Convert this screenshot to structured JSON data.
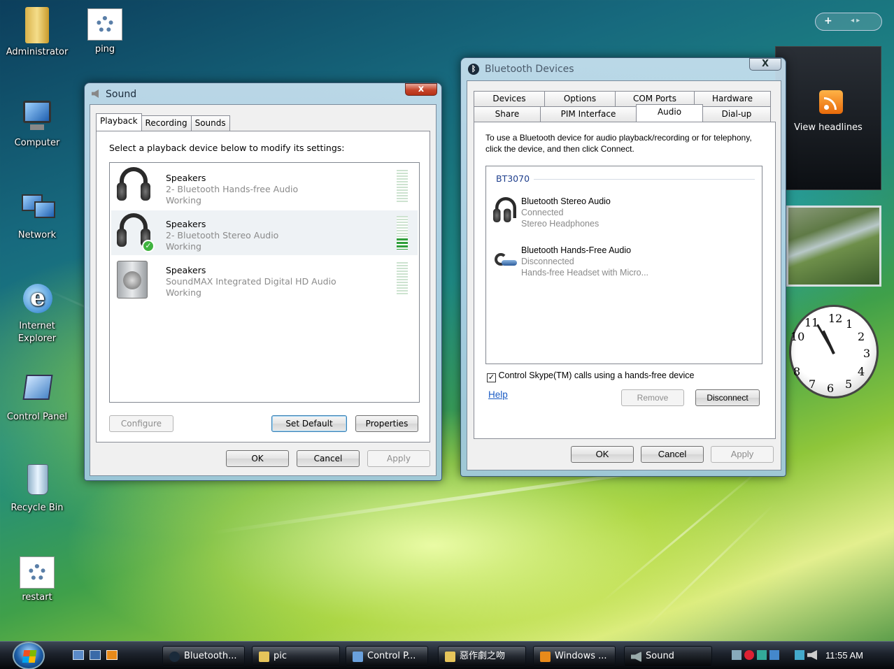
{
  "desktop": {
    "icons": [
      {
        "label": "Administrator"
      },
      {
        "label": "ping"
      },
      {
        "label": "Computer"
      },
      {
        "label": "Network"
      },
      {
        "label": "Internet Explorer"
      },
      {
        "label": "Control Panel"
      },
      {
        "label": "Recycle Bin"
      },
      {
        "label": "restart"
      }
    ]
  },
  "sidebar": {
    "add_label": "+",
    "nav_label": "◂ ▸",
    "feed_label": "View headlines",
    "clock_numbers": [
      "12",
      "1",
      "2",
      "3",
      "4",
      "5",
      "6",
      "7",
      "8",
      "10",
      "11"
    ]
  },
  "sound": {
    "title": "Sound",
    "close_glyph": "x",
    "tabs": [
      "Playback",
      "Recording",
      "Sounds"
    ],
    "instruction": "Select a playback device below to modify its settings:",
    "devices": [
      {
        "name": "Speakers",
        "desc": "2- Bluetooth Hands-free Audio",
        "status": "Working"
      },
      {
        "name": "Speakers",
        "desc": "2- Bluetooth Stereo Audio",
        "status": "Working"
      },
      {
        "name": "Speakers",
        "desc": "SoundMAX Integrated Digital HD Audio",
        "status": "Working"
      }
    ],
    "buttons": {
      "configure": "Configure",
      "set_default": "Set Default",
      "properties": "Properties",
      "ok": "OK",
      "cancel": "Cancel",
      "apply": "Apply"
    }
  },
  "bluetooth": {
    "title": "Bluetooth Devices",
    "close_glyph": "X",
    "tabs_row1": [
      "Devices",
      "Options",
      "COM Ports",
      "Hardware"
    ],
    "tabs_row2": [
      "Share",
      "PIM Interface",
      "Audio",
      "Dial-up"
    ],
    "instruction": "To use a Bluetooth device for audio playback/recording or for telephony, click the device, and then click Connect.",
    "group_name": "BT3070",
    "devices": [
      {
        "name": "Bluetooth Stereo Audio",
        "status": "Connected",
        "desc": "Stereo Headphones"
      },
      {
        "name": "Bluetooth Hands-Free Audio",
        "status": "Disconnected",
        "desc": "Hands-free Headset with Micro..."
      }
    ],
    "skype_checkbox": "Control Skype(TM) calls using a hands-free device",
    "help_link": "Help",
    "buttons": {
      "remove": "Remove",
      "disconnect": "Disconnect",
      "ok": "OK",
      "cancel": "Cancel",
      "apply": "Apply"
    }
  },
  "taskbar": {
    "items": [
      {
        "label": "Bluetooth..."
      },
      {
        "label": "pic"
      },
      {
        "label": "Control P..."
      },
      {
        "label": "惡作劇之吻"
      },
      {
        "label": "Windows ..."
      },
      {
        "label": "Sound"
      }
    ],
    "clock": "11:55 AM"
  }
}
